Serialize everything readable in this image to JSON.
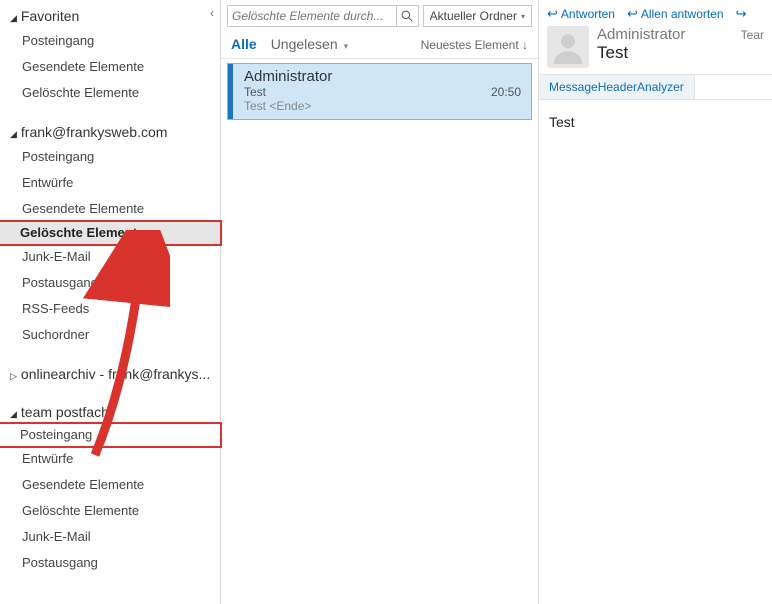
{
  "nav": {
    "favorites": {
      "label": "Favoriten",
      "items": [
        "Posteingang",
        "Gesendete Elemente",
        "Gelöschte Elemente"
      ]
    },
    "account1": {
      "label": "frank@frankysweb.com",
      "items": [
        "Posteingang",
        "Entwürfe",
        "Gesendete Elemente",
        "Gelöschte Elemente",
        "Junk-E-Mail",
        "Postausgang",
        "RSS-Feeds",
        "Suchordner"
      ],
      "selected_index": 3
    },
    "account2": {
      "label": "onlinearchiv - frank@frankys..."
    },
    "account3": {
      "label": "team postfach",
      "items": [
        "Posteingang",
        "Entwürfe",
        "Gesendete Elemente",
        "Gelöschte Elemente",
        "Junk-E-Mail",
        "Postausgang"
      ],
      "highlight_index": 0
    }
  },
  "mid": {
    "search_placeholder": "Gelöschte Elemente durch...",
    "scope_label": "Aktueller Ordner",
    "filter_all": "Alle",
    "filter_unread": "Ungelesen",
    "sort_label": "Neuestes Element ↓",
    "message": {
      "from": "Administrator",
      "subject": "Test",
      "time": "20:50",
      "preview": "Test <Ende>"
    }
  },
  "pane": {
    "actions": {
      "reply": "Antworten",
      "reply_all": "Allen antworten",
      "forward": ""
    },
    "team_label": "Tear",
    "from": "Administrator",
    "subject": "Test",
    "tab": "MessageHeaderAnalyzer",
    "body": "Test"
  }
}
